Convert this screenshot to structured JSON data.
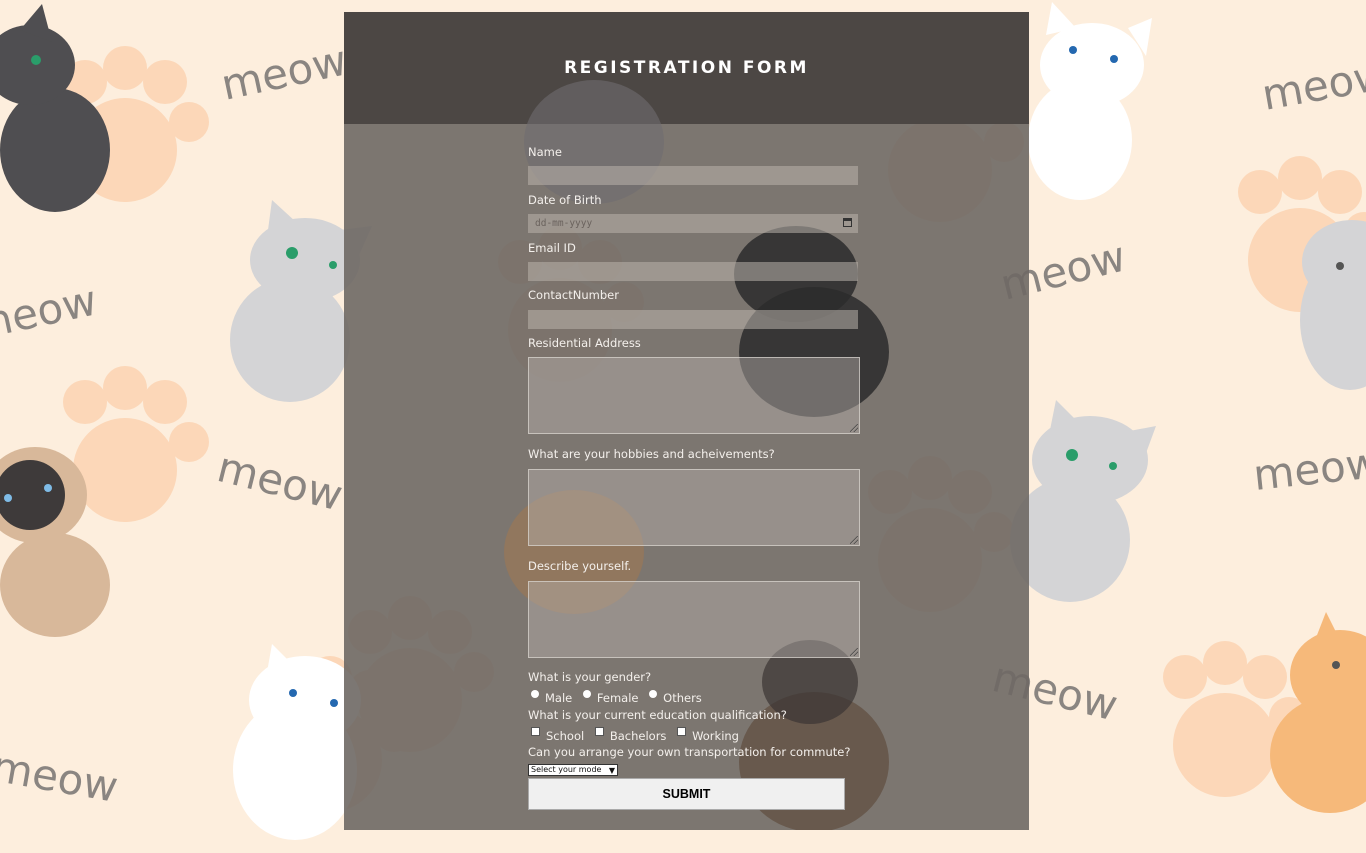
{
  "theme": {
    "page_bg": "#fdeedd",
    "panel": "#6e6864",
    "header": "#484441",
    "text": "#ffffff"
  },
  "background_words": {
    "meow": "meow"
  },
  "form": {
    "title": "REGISTRATION FORM",
    "name_label": "Name",
    "dob_label": "Date of Birth",
    "dob_placeholder": "dd-mm-yyyy",
    "email_label": "Email ID",
    "contact_label": "ContactNumber",
    "address_label": "Residential Address",
    "hobbies_label": "What are your hobbies and acheivements?",
    "describe_label": "Describe yourself.",
    "gender_label": "What is your gender?",
    "gender_options": [
      "Male",
      "Female",
      "Others"
    ],
    "education_label": "What is your current education qualification?",
    "education_options": [
      "School",
      "Bachelors",
      "Working"
    ],
    "transport_label": "Can you arrange your own transportation for commute?",
    "transport_selected": "Select your mode",
    "submit_label": "SUBMIT"
  }
}
